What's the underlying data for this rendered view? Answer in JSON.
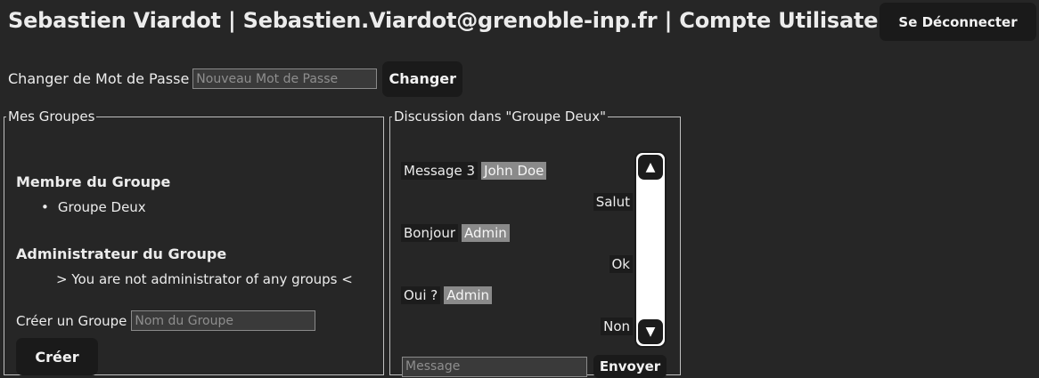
{
  "header": {
    "title": "Sebastien Viardot | Sebastien.Viardot@grenoble-inp.fr | Compte Utilisateur",
    "logout_label": "Se Déconnecter"
  },
  "password": {
    "label": "Changer de Mot de Passe",
    "placeholder": "Nouveau Mot de Passe",
    "button_label": "Changer"
  },
  "groups": {
    "legend": "Mes Groupes",
    "member_title": "Membre du Groupe",
    "member_items": [
      "Groupe Deux"
    ],
    "admin_title": "Administrateur du Groupe",
    "admin_empty": "> You are not administrator of any groups <",
    "create_label": "Créer un Groupe",
    "create_placeholder": "Nom du Groupe",
    "create_button": "Créer"
  },
  "discussion": {
    "legend": "Discussion dans \"Groupe Deux\"",
    "messages": [
      {
        "text": "Message 3",
        "author": "John Doe"
      },
      {
        "reply": "Salut"
      },
      {
        "text": "Bonjour",
        "author": "Admin"
      },
      {
        "reply": "Ok"
      },
      {
        "text": "Oui ?",
        "author": "Admin"
      },
      {
        "reply": "Non"
      }
    ],
    "scroll_up_icon": "▲",
    "scroll_down_icon": "▼",
    "message_placeholder": "Message",
    "send_label": "Envoyer"
  }
}
